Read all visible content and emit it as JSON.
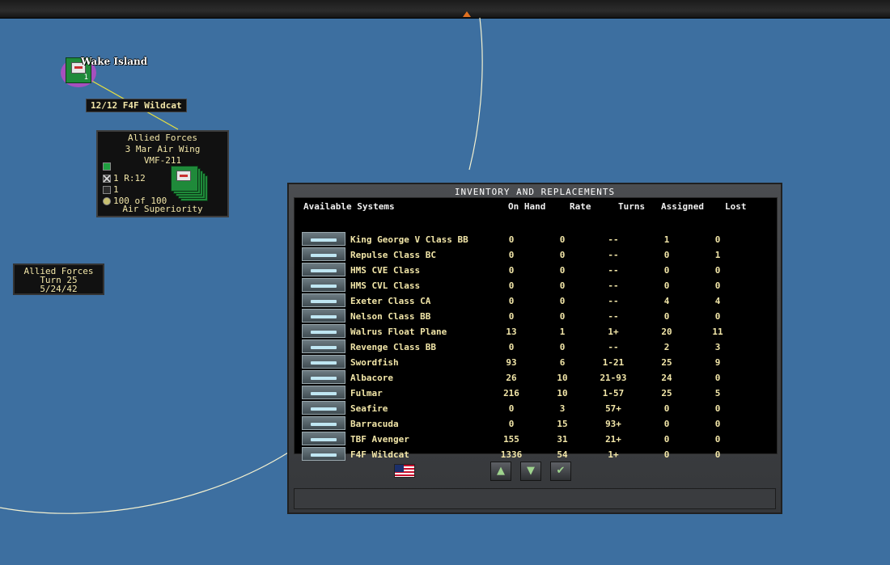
{
  "map": {
    "base_name": "Wake Island",
    "base_unit_number": "1",
    "base_label": "12/12 F4F Wildcat",
    "unit_box": {
      "side": "Allied Forces",
      "unit": "3 Mar Air Wing",
      "squadron": "VMF-211",
      "row1": "1 R:12",
      "row2": "1",
      "row3": "100 of 100",
      "mission": "Air Superiority"
    },
    "turn_box": {
      "side": "Allied Forces",
      "turn": "Turn 25",
      "date": "5/24/42"
    }
  },
  "dialog": {
    "title": "INVENTORY AND REPLACEMENTS",
    "columns": {
      "system": "Available Systems",
      "on_hand": "On Hand",
      "rate": "Rate",
      "turns": "Turns",
      "assigned": "Assigned",
      "lost": "Lost"
    },
    "rows": [
      {
        "name": "King George V Class BB",
        "on_hand": "0",
        "rate": "0",
        "turns": "--",
        "assigned": "1",
        "lost": "0",
        "icon": "ship-icon"
      },
      {
        "name": "Repulse Class BC",
        "on_hand": "0",
        "rate": "0",
        "turns": "--",
        "assigned": "0",
        "lost": "1",
        "icon": "ship-icon"
      },
      {
        "name": "HMS CVE Class",
        "on_hand": "0",
        "rate": "0",
        "turns": "--",
        "assigned": "0",
        "lost": "0",
        "icon": "ship-icon"
      },
      {
        "name": "HMS CVL Class",
        "on_hand": "0",
        "rate": "0",
        "turns": "--",
        "assigned": "0",
        "lost": "0",
        "icon": "ship-icon"
      },
      {
        "name": "Exeter Class CA",
        "on_hand": "0",
        "rate": "0",
        "turns": "--",
        "assigned": "4",
        "lost": "4",
        "icon": "ship-icon"
      },
      {
        "name": "Nelson Class BB",
        "on_hand": "0",
        "rate": "0",
        "turns": "--",
        "assigned": "0",
        "lost": "0",
        "icon": "ship-icon"
      },
      {
        "name": "Walrus Float Plane",
        "on_hand": "13",
        "rate": "1",
        "turns": "1+",
        "assigned": "20",
        "lost": "11",
        "icon": "plane-icon"
      },
      {
        "name": "Revenge Class BB",
        "on_hand": "0",
        "rate": "0",
        "turns": "--",
        "assigned": "2",
        "lost": "3",
        "icon": "ship-icon"
      },
      {
        "name": "Swordfish",
        "on_hand": "93",
        "rate": "6",
        "turns": "1-21",
        "assigned": "25",
        "lost": "9",
        "icon": "plane-icon"
      },
      {
        "name": "Albacore",
        "on_hand": "26",
        "rate": "10",
        "turns": "21-93",
        "assigned": "24",
        "lost": "0",
        "icon": "plane-icon"
      },
      {
        "name": "Fulmar",
        "on_hand": "216",
        "rate": "10",
        "turns": "1-57",
        "assigned": "25",
        "lost": "5",
        "icon": "plane-icon"
      },
      {
        "name": "Seafire",
        "on_hand": "0",
        "rate": "3",
        "turns": "57+",
        "assigned": "0",
        "lost": "0",
        "icon": "plane-icon"
      },
      {
        "name": "Barracuda",
        "on_hand": "0",
        "rate": "15",
        "turns": "93+",
        "assigned": "0",
        "lost": "0",
        "icon": "plane-icon"
      },
      {
        "name": "TBF Avenger",
        "on_hand": "155",
        "rate": "31",
        "turns": "21+",
        "assigned": "0",
        "lost": "0",
        "icon": "plane-icon"
      },
      {
        "name": "F4F Wildcat",
        "on_hand": "1336",
        "rate": "54",
        "turns": "1+",
        "assigned": "0",
        "lost": "0",
        "icon": "plane-icon"
      }
    ],
    "buttons": {
      "up": "▲",
      "down": "▼",
      "ok": "✔"
    },
    "status_text": ""
  },
  "colors": {
    "ocean": "#3d6fa0",
    "text_yellow": "#f2e6a8",
    "highlight_circle": "#e8e040"
  }
}
